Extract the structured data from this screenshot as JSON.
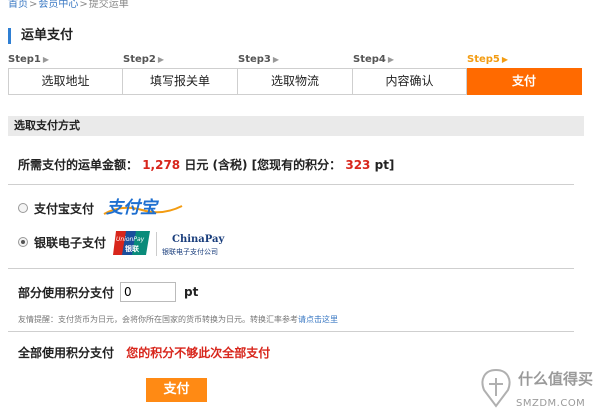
{
  "breadcrumb": {
    "home": "首页",
    "sep1": ">",
    "member_center": "会员中心",
    "sep2": ">",
    "current": "提交运单"
  },
  "page_title": "运单支付",
  "steps": [
    {
      "label": "Step1",
      "name": "选取地址",
      "active": false
    },
    {
      "label": "Step2",
      "name": "填写报关单",
      "active": false
    },
    {
      "label": "Step3",
      "name": "选取物流",
      "active": false
    },
    {
      "label": "Step4",
      "name": "内容确认",
      "active": false
    },
    {
      "label": "Step5",
      "name": "支付",
      "active": true
    }
  ],
  "section_title": "选取支付方式",
  "amount": {
    "prefix": "所需支付的运单金额：",
    "value": "1,278",
    "unit": "日元 (含税) [您现有的积分：",
    "points": "323",
    "points_unit": "pt]"
  },
  "payment_options": [
    {
      "label": "支付宝支付",
      "selected": false,
      "logo_text": "支付宝"
    },
    {
      "label": "银联电子支付",
      "selected": true,
      "logo_text_1": "UnionPay",
      "logo_text_2": "银联",
      "logo_text_3": "ChinaPay",
      "logo_text_4": "银联电子支付公司"
    }
  ],
  "partial_points": {
    "label": "部分使用积分支付",
    "value": "0",
    "unit": "pt"
  },
  "tip": {
    "text": "友情提醒：支付货币为日元，会将你所在国家的货币转换为日元。转换汇率参考",
    "link": "请点击这里"
  },
  "all_points": {
    "label": "全部使用积分支付",
    "warning": "您的积分不够此次全部支付"
  },
  "pay_button": "支付",
  "watermark": {
    "text": "什么值得买",
    "url": "SMZDM.COM"
  },
  "colors": {
    "accent": "#ff6a00",
    "button": "#ff8a14",
    "warning": "#d8261c",
    "title_bar": "#2f7fd3",
    "link": "#3a78c3"
  }
}
